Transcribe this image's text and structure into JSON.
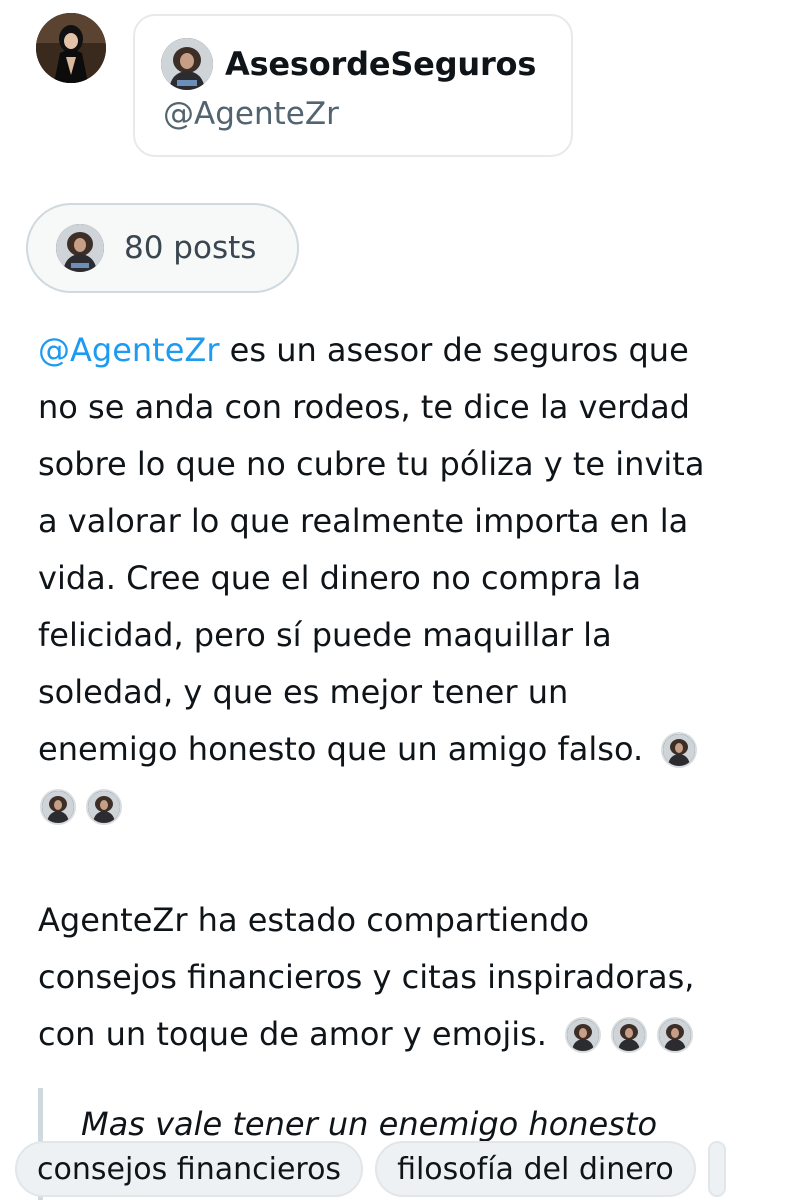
{
  "profile": {
    "name": "AsesordeSeguros",
    "handle": "@AgenteZr"
  },
  "posts_pill": {
    "label": "80 posts"
  },
  "bio": {
    "mention": "@AgenteZr",
    "lines": [
      " es un asesor de seguros que",
      "no se anda con rodeos, te dice la verdad",
      "sobre lo que no cubre tu póliza y te invita",
      "a valorar lo que realmente importa en la",
      "vida. Cree que el dinero no compra la",
      "felicidad, pero sí puede maquillar la",
      "soledad, y que es mejor tener un",
      "enemigo honesto que un amigo falso."
    ]
  },
  "summary": {
    "lines": [
      "AgenteZr ha estado compartiendo",
      "consejos financieros y citas inspiradoras,",
      "con un toque de amor y emojis."
    ]
  },
  "quote": {
    "text": "Mas vale tener un enemigo honesto"
  },
  "tags": [
    "consejos financieros",
    "filosofía del dinero"
  ],
  "colors": {
    "link": "#1d9bf0",
    "muted": "#536471",
    "border": "#e7e9ea"
  },
  "icons": [
    "avatar-portrait-icon",
    "profile-avatar-icon",
    "portrait-emoji-icon"
  ]
}
